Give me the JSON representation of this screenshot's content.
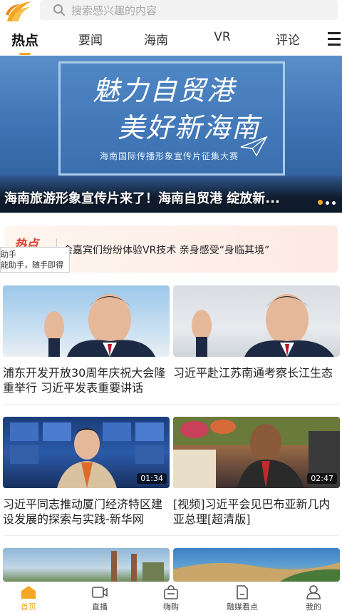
{
  "search": {
    "placeholder": "搜索感兴趣的内容"
  },
  "tabs": [
    {
      "label": "热点",
      "active": true
    },
    {
      "label": "要闻"
    },
    {
      "label": "海南"
    },
    {
      "label": "VR"
    },
    {
      "label": "评论"
    }
  ],
  "banner": {
    "calligraphy_line1": "魅力自贸港",
    "calligraphy_line2": "美好新海南",
    "subtitle": "海南国际传播形象宣传片征集大赛",
    "headline": "海南旅游形象宣传片来了！海南自贸港 绽放新..."
  },
  "hot": {
    "label": "热点",
    "headline": "会嘉宾们纷纷体验VR技术 亲身感受“身临其境”"
  },
  "tooltip": {
    "line1": "助手",
    "line2": "能助手，随手即得"
  },
  "news": [
    {
      "caption": "浦东开发开放30周年庆祝大会隆重举行 习近平发表重要讲话"
    },
    {
      "caption": "习近平赴江苏南通考察长江生态"
    },
    {
      "caption": "习近平同志推动厦门经济特区建设发展的探索与实践-新华网",
      "duration": "01:34"
    },
    {
      "caption": "[视频]习近平会见巴布亚新几内亚总理[超清版]",
      "duration": "02:47"
    }
  ],
  "bottom_nav": [
    {
      "label": "首页",
      "icon": "home-icon",
      "active": true
    },
    {
      "label": "直播",
      "icon": "live-icon"
    },
    {
      "label": "嗨购",
      "icon": "shop-icon"
    },
    {
      "label": "融媒看点",
      "icon": "media-icon"
    },
    {
      "label": "我的",
      "icon": "profile-icon"
    }
  ],
  "colors": {
    "accent": "#f5a623",
    "hot_red": "#e23a2e"
  }
}
